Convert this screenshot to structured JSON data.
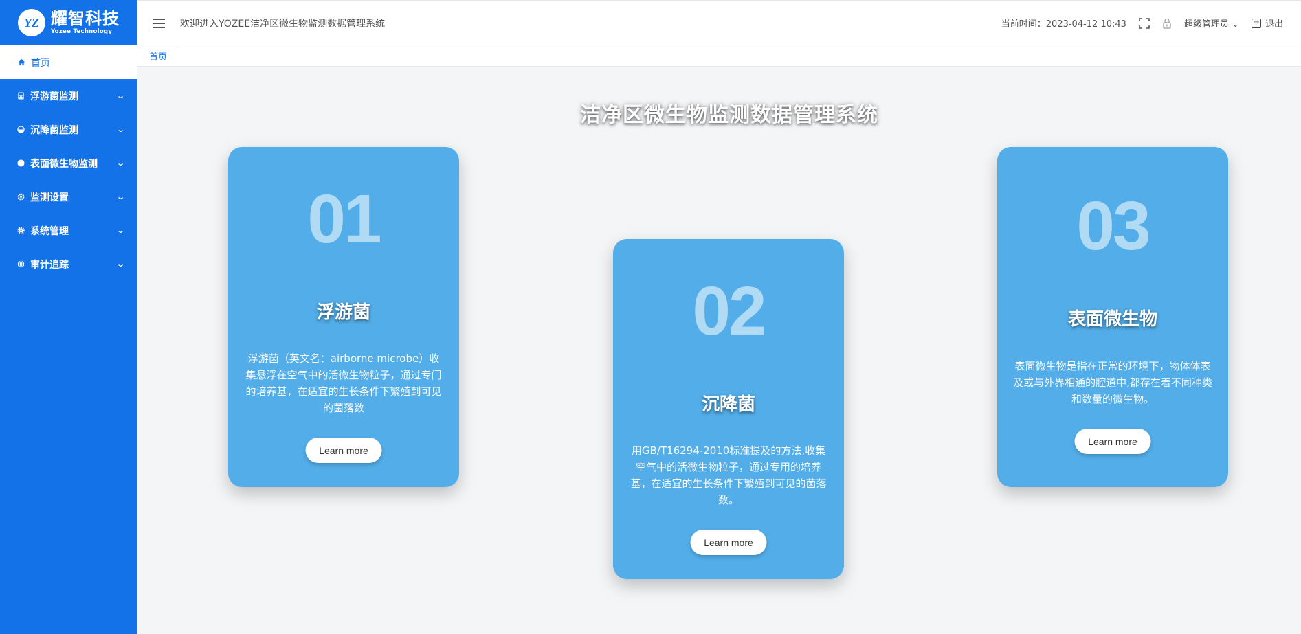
{
  "logo": {
    "mark": "YZ",
    "name_cn": "耀智科技",
    "name_en": "Yozee Technology"
  },
  "sidebar": {
    "home": {
      "label": "首页",
      "icon": "home-icon"
    },
    "items": [
      {
        "label": "浮游菌监测",
        "icon": "calculator-icon"
      },
      {
        "label": "沉降菌监测",
        "icon": "pie-chart-icon"
      },
      {
        "label": "表面微生物监测",
        "icon": "circle-icon"
      },
      {
        "label": "监测设置",
        "icon": "settings-icon"
      },
      {
        "label": "系统管理",
        "icon": "gear-icon"
      },
      {
        "label": "审计追踪",
        "icon": "globe-icon"
      }
    ]
  },
  "header": {
    "welcome": "欢迎进入YOZEE洁净区微生物监测数据管理系统",
    "time_label": "当前时间：2023-04-12 10:43",
    "user": "超级管理员",
    "logout": "退出"
  },
  "tabs": [
    {
      "label": "首页"
    }
  ],
  "main": {
    "title": "洁净区微生物监测数据管理系统",
    "cards": [
      {
        "num": "01",
        "title": "浮游菌",
        "desc": "浮游菌（英文名：airborne microbe）收集悬浮在空气中的活微生物粒子，通过专门的培养基，在适宜的生长条件下繁殖到可见的菌落数",
        "button": "Learn more"
      },
      {
        "num": "02",
        "title": "沉降菌",
        "desc": "用GB/T16294-2010标准提及的方法,收集空气中的活微生物粒子，通过专用的培养基，在适宜的生长条件下繁殖到可见的菌落数。",
        "button": "Learn more"
      },
      {
        "num": "03",
        "title": "表面微生物",
        "desc": "表面微生物是指在正常的环境下，物体体表及或与外界相通的腔道中,都存在着不同种类和数量的微生物。",
        "button": "Learn more"
      }
    ]
  },
  "colors": {
    "sidebar": "#1472e8",
    "card": "#52ade8",
    "background": "#f4f5f7"
  }
}
